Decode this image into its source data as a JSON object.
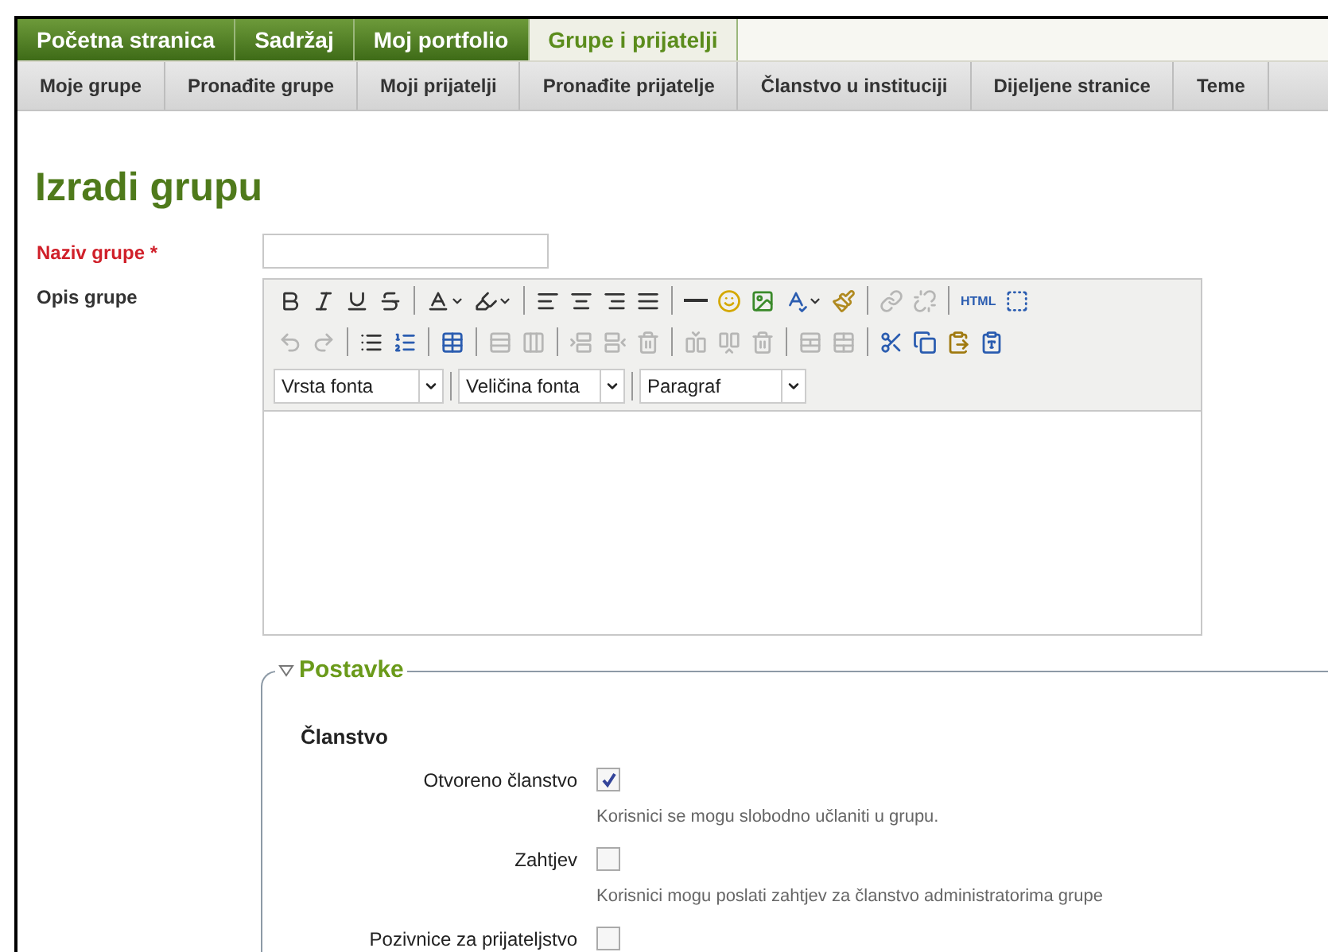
{
  "main_tabs": [
    {
      "label": "Početna stranica",
      "selected": false
    },
    {
      "label": "Sadržaj",
      "selected": false
    },
    {
      "label": "Moj portfolio",
      "selected": false
    },
    {
      "label": "Grupe i prijatelji",
      "selected": true
    }
  ],
  "sub_tabs": [
    {
      "label": "Moje grupe"
    },
    {
      "label": "Pronađite grupe"
    },
    {
      "label": "Moji prijatelji"
    },
    {
      "label": "Pronađite prijatelje"
    },
    {
      "label": "Članstvo u instituciji"
    },
    {
      "label": "Dijeljene stranice"
    },
    {
      "label": "Teme"
    }
  ],
  "page_title": "Izradi grupu",
  "name_field": {
    "label": "Naziv grupe *",
    "required": true
  },
  "description_field": {
    "label": "Opis grupe",
    "toolbar_rows": [
      [
        [
          {
            "kind": "bold",
            "disabled": false
          },
          {
            "kind": "italic",
            "disabled": false
          },
          {
            "kind": "underline",
            "disabled": false
          },
          {
            "kind": "strike",
            "disabled": false
          }
        ],
        [
          {
            "kind": "forecolor",
            "disabled": false
          },
          {
            "kind": "highlight",
            "disabled": false
          }
        ],
        [
          {
            "kind": "align-left",
            "disabled": false
          },
          {
            "kind": "align-center",
            "disabled": false
          },
          {
            "kind": "align-right",
            "disabled": false
          },
          {
            "kind": "justify",
            "disabled": false
          }
        ],
        [
          {
            "kind": "rule",
            "disabled": false
          },
          {
            "kind": "emoji",
            "disabled": false
          },
          {
            "kind": "image",
            "disabled": false
          },
          {
            "kind": "spellcheck",
            "disabled": false
          },
          {
            "kind": "cleanup",
            "disabled": false
          }
        ],
        [
          {
            "kind": "link",
            "disabled": true
          },
          {
            "kind": "unlink",
            "disabled": true
          }
        ],
        [
          {
            "kind": "html",
            "label": "HTML",
            "disabled": false
          },
          {
            "kind": "fullscreen",
            "disabled": false
          }
        ]
      ],
      [
        [
          {
            "kind": "undo",
            "disabled": true
          },
          {
            "kind": "redo",
            "disabled": true
          }
        ],
        [
          {
            "kind": "bullets",
            "disabled": false
          },
          {
            "kind": "numbers",
            "disabled": false
          }
        ],
        [
          {
            "kind": "table",
            "disabled": false
          }
        ],
        [
          {
            "kind": "row-props",
            "disabled": true
          },
          {
            "kind": "cell-props",
            "disabled": true
          }
        ],
        [
          {
            "kind": "row-before",
            "disabled": true
          },
          {
            "kind": "row-after",
            "disabled": true
          },
          {
            "kind": "delete-row",
            "disabled": true
          }
        ],
        [
          {
            "kind": "col-before",
            "disabled": true
          },
          {
            "kind": "col-after",
            "disabled": true
          },
          {
            "kind": "delete-col",
            "disabled": true
          }
        ],
        [
          {
            "kind": "split",
            "disabled": true
          },
          {
            "kind": "merge",
            "disabled": true
          }
        ],
        [
          {
            "kind": "cut",
            "disabled": false
          },
          {
            "kind": "copy",
            "disabled": false
          },
          {
            "kind": "paste",
            "disabled": false
          },
          {
            "kind": "paste-word",
            "disabled": false
          }
        ]
      ]
    ],
    "selects": [
      {
        "value": "Vrsta fonta"
      },
      {
        "value": "Veličina fonta"
      },
      {
        "value": "Paragraf"
      }
    ]
  },
  "settings": {
    "legend": "Postavke",
    "expanded": true,
    "section": "Članstvo",
    "options": [
      {
        "label": "Otvoreno članstvo",
        "checked": true,
        "description": "Korisnici se mogu slobodno učlaniti u grupu."
      },
      {
        "label": "Zahtjev",
        "checked": false,
        "description": "Korisnici mogu poslati zahtjev za članstvo administratorima grupe"
      },
      {
        "label": "Pozivnice za prijateljstvo",
        "checked": false
      }
    ]
  }
}
